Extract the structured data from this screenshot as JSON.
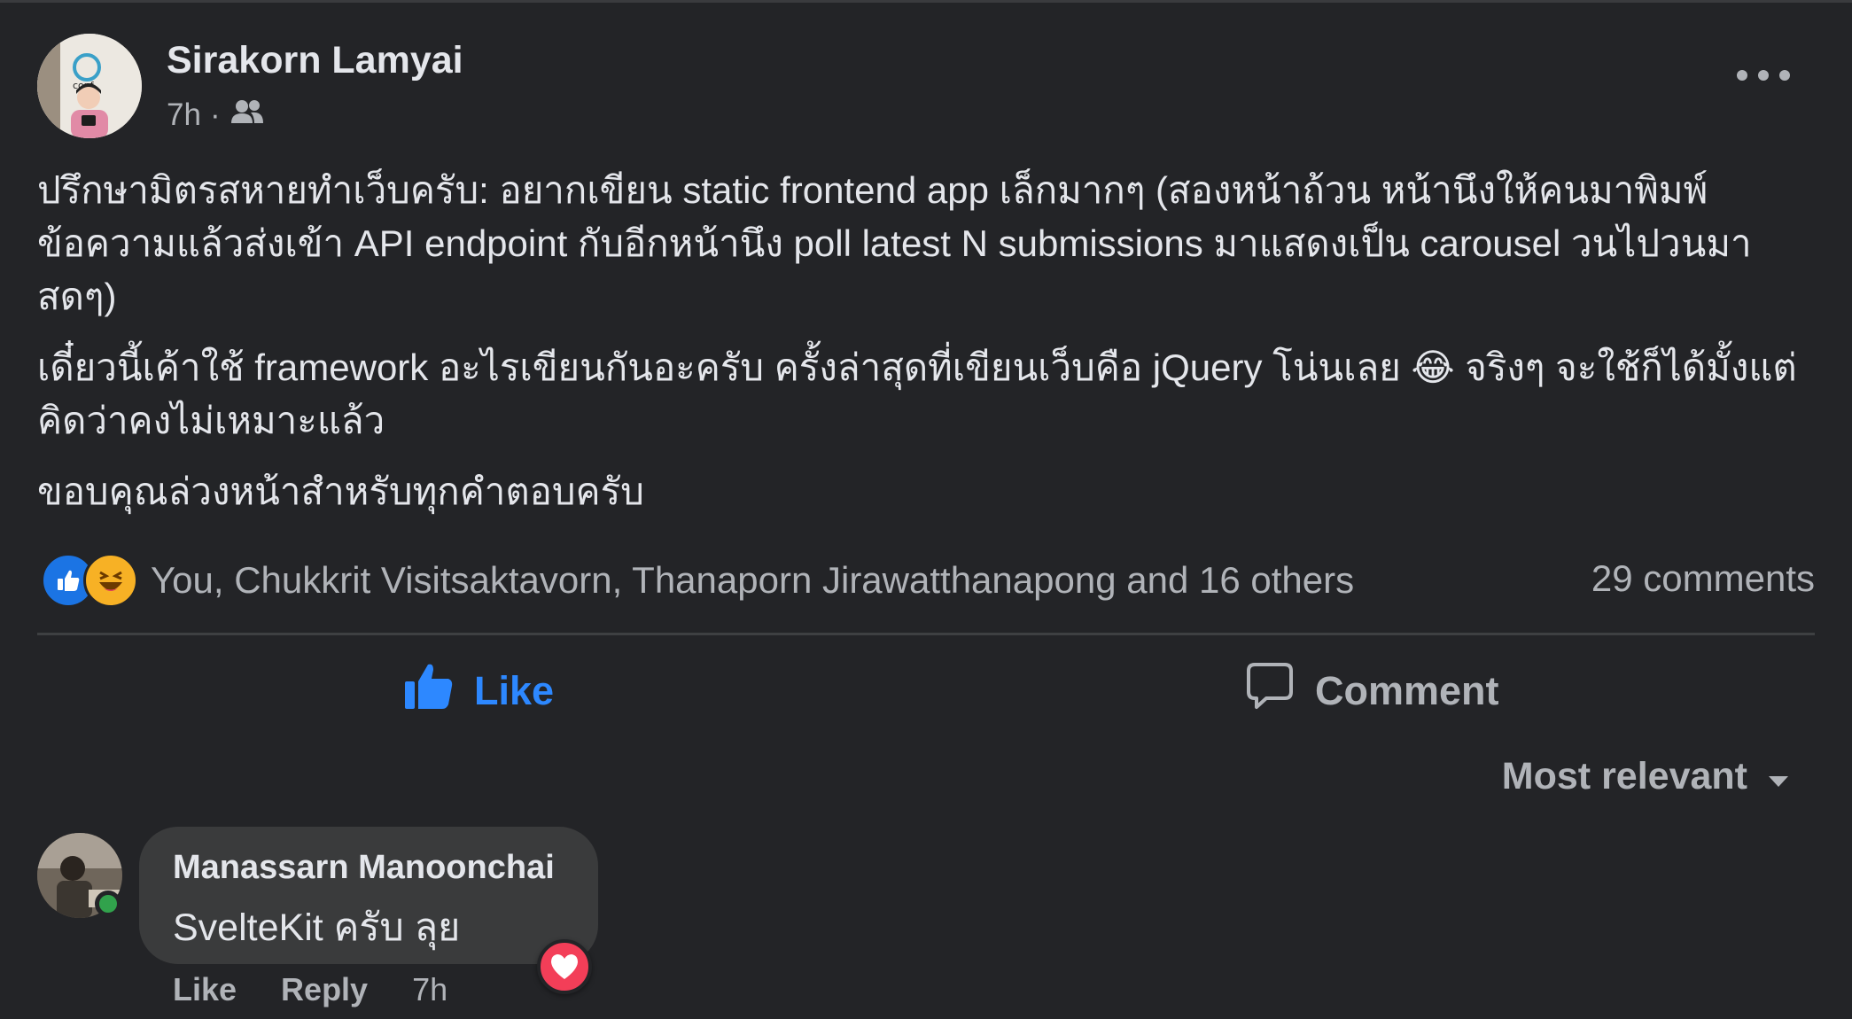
{
  "post": {
    "author": "Sirakorn Lamyai",
    "time": "7h",
    "separator": "·",
    "paragraphs": [
      "ปรึกษามิตรสหายทำเว็บครับ: อยากเขียน static frontend app เล็กมากๆ (สองหน้าถ้วน หน้านึงให้คนมาพิมพ์ข้อความแล้วส่งเข้า API endpoint กับอีกหน้านึง poll latest N submissions มาแสดงเป็น carousel วนไปวนมาสดๆ)",
      "ขอบคุณล่วงหน้าสำหรับทุกคำตอบครับ"
    ],
    "paragraph2_part1": "เดี๋ยวนี้เค้าใช้ framework อะไรเขียนกันอะครับ ครั้งล่าสุดที่เขียนเว็บคือ jQuery โน่นเลย",
    "paragraph2_emoji": "😂",
    "paragraph2_part2": "จริงๆ จะใช้ก็ได้มั้งแต่คิดว่าคงไม่เหมาะแล้ว"
  },
  "reactions": {
    "summary": "You, Chukkrit Visitsaktavorn, Thanaporn Jirawatthanapong and 16 others",
    "comments_count": "29 comments",
    "icons": [
      "like-reaction-icon",
      "haha-reaction-icon"
    ]
  },
  "actions": {
    "like_label": "Like",
    "comment_label": "Comment"
  },
  "sort": {
    "label": "Most relevant"
  },
  "comment": {
    "author": "Manassarn Manoonchai",
    "text": "SvelteKit ครับ ลุย",
    "like_label": "Like",
    "reply_label": "Reply",
    "time": "7h",
    "reaction": "love-reaction-icon",
    "online": true
  },
  "colors": {
    "background": "#232427",
    "accent": "#2d88ff",
    "text": "#e4e6eb",
    "muted": "#b0b3b8",
    "online": "#31a24c",
    "love": "#f33e58"
  }
}
